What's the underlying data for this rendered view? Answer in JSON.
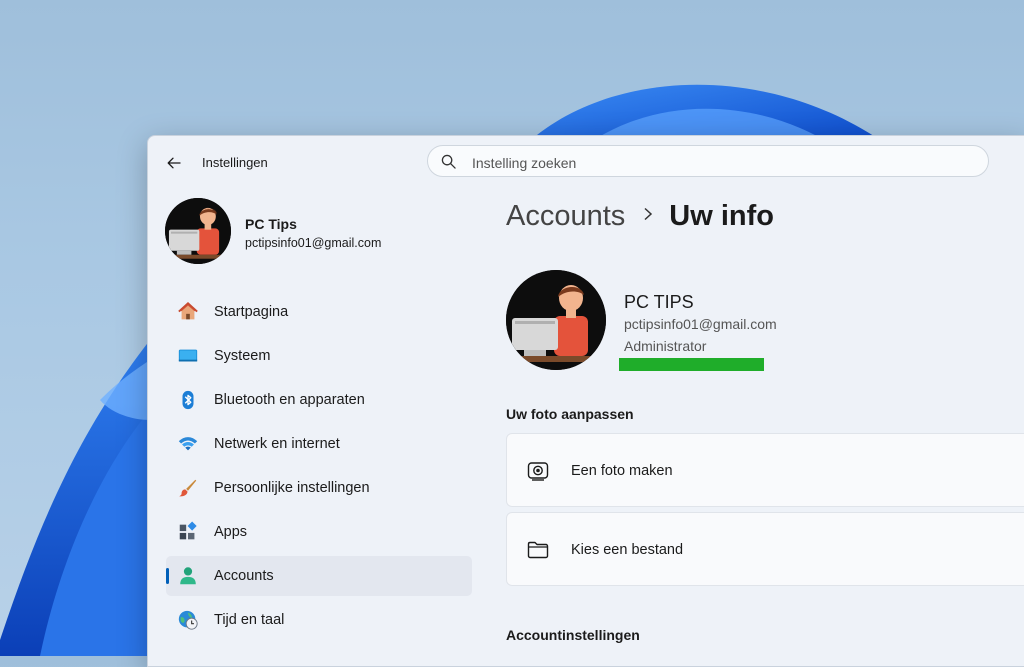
{
  "window": {
    "title": "Instellingen"
  },
  "search": {
    "placeholder": "Instelling zoeken"
  },
  "profile": {
    "name": "PC Tips",
    "email": "pctipsinfo01@gmail.com"
  },
  "sidebar": {
    "items": [
      {
        "label": "Startpagina",
        "icon": "home-icon"
      },
      {
        "label": "Systeem",
        "icon": "monitor-icon"
      },
      {
        "label": "Bluetooth en apparaten",
        "icon": "bluetooth-icon"
      },
      {
        "label": "Netwerk en internet",
        "icon": "wifi-icon"
      },
      {
        "label": "Persoonlijke instellingen",
        "icon": "brush-icon"
      },
      {
        "label": "Apps",
        "icon": "apps-icon"
      },
      {
        "label": "Accounts",
        "icon": "person-icon",
        "active": true
      },
      {
        "label": "Tijd en taal",
        "icon": "globe-clock-icon"
      }
    ]
  },
  "breadcrumb": {
    "parent": "Accounts",
    "current": "Uw info"
  },
  "user": {
    "name": "PC TIPS",
    "email": "pctipsinfo01@gmail.com",
    "role": "Administrator"
  },
  "photo_section": {
    "title": "Uw foto aanpassen",
    "options": [
      {
        "label": "Een foto maken",
        "icon": "camera-icon"
      },
      {
        "label": "Kies een bestand",
        "icon": "folder-icon"
      }
    ]
  },
  "account_section": {
    "title": "Accountinstellingen"
  },
  "colors": {
    "accent": "#005fb8",
    "redaction": "#1fad2a"
  }
}
